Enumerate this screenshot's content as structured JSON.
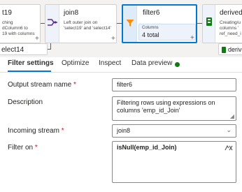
{
  "pipeline": {
    "nodes": [
      {
        "title": "t19",
        "desc": "ching\ndColumn6 to\n19 with columns"
      },
      {
        "title": "join8",
        "desc": "Left outer join on\n'select19' and 'select14'"
      },
      {
        "title": "filter6",
        "sub_label": "Columns",
        "sub_value": "4 total"
      },
      {
        "title": "derivedC",
        "desc": "Creating/u\ncolumns '\nref_need_i"
      }
    ],
    "lower_left": "elect14",
    "lower_right": "deriv",
    "plus": "+"
  },
  "tabs": [
    {
      "label": "Filter settings",
      "active": true
    },
    {
      "label": "Optimize",
      "active": false
    },
    {
      "label": "Inspect",
      "active": false
    },
    {
      "label": "Data preview",
      "active": false,
      "status_color": "#107c10"
    }
  ],
  "form": {
    "output_stream_name": {
      "label": "Output stream name",
      "required_mark": "*",
      "value": "filter6"
    },
    "description": {
      "label": "Description",
      "value": "Filtering rows using expressions on\ncolumns 'emp_id_Join'"
    },
    "incoming_stream": {
      "label": "Incoming stream",
      "required_mark": "*",
      "value": "join8"
    },
    "filter_on": {
      "label": "Filter on",
      "required_mark": "*",
      "value": "isNull(emp_id_Join)"
    }
  },
  "colors": {
    "accent": "#0078d4",
    "status": "#107c10",
    "required": "#a4262c"
  }
}
